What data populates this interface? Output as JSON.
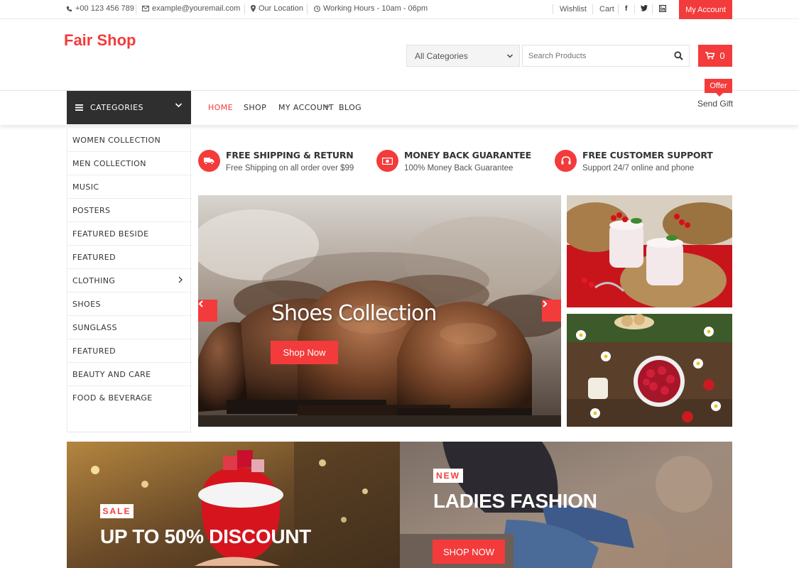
{
  "topbar": {
    "phone": "+00 123 456 789",
    "email": "example@youremail.com",
    "location": "Our Location",
    "hours": "Working Hours - 10am - 06pm",
    "wishlist": "Wishlist",
    "cart": "Cart",
    "social": [
      "facebook-icon",
      "twitter-icon",
      "linkedin-icon"
    ],
    "my_account": "My Account"
  },
  "header": {
    "logo": "Fair Shop",
    "category_select": "All Categories",
    "search_placeholder": "Search Products",
    "cart_count": "0"
  },
  "nav": {
    "categories_label": "CATEGORIES",
    "links": [
      "HOME",
      "SHOP",
      "MY ACCOUNT",
      "BLOG"
    ],
    "offer_badge": "Offer",
    "send_gift": "Send Gift"
  },
  "sidebar": {
    "items": [
      "WOMEN COLLECTION",
      "MEN COLLECTION",
      "MUSIC",
      "POSTERS",
      "FEATURED BESIDE",
      "FEATURED",
      "CLOTHING",
      "SHOES",
      "SUNGLASS",
      "FEATURED",
      "BEAUTY AND CARE",
      "FOOD & BEVERAGE"
    ]
  },
  "features": [
    {
      "title": "FREE SHIPPING & RETURN",
      "subtitle": "Free Shipping on all order over $99",
      "icon": "truck-icon"
    },
    {
      "title": "MONEY BACK GUARANTEE",
      "subtitle": "100% Money Back Guarantee",
      "icon": "money-icon"
    },
    {
      "title": "FREE CUSTOMER SUPPORT",
      "subtitle": "Support 24/7 online and phone",
      "icon": "headset-icon"
    }
  ],
  "slider": {
    "title": "Shoes Collection",
    "button": "Shop Now"
  },
  "banners": [
    {
      "tag": "SALE",
      "title": "UP TO 50% DISCOUNT"
    },
    {
      "tag": "NEW",
      "title": "LADIES FASHION",
      "button": "SHOP NOW"
    }
  ],
  "colors": {
    "accent": "#f33b3b",
    "dark": "#2f2f2f"
  }
}
